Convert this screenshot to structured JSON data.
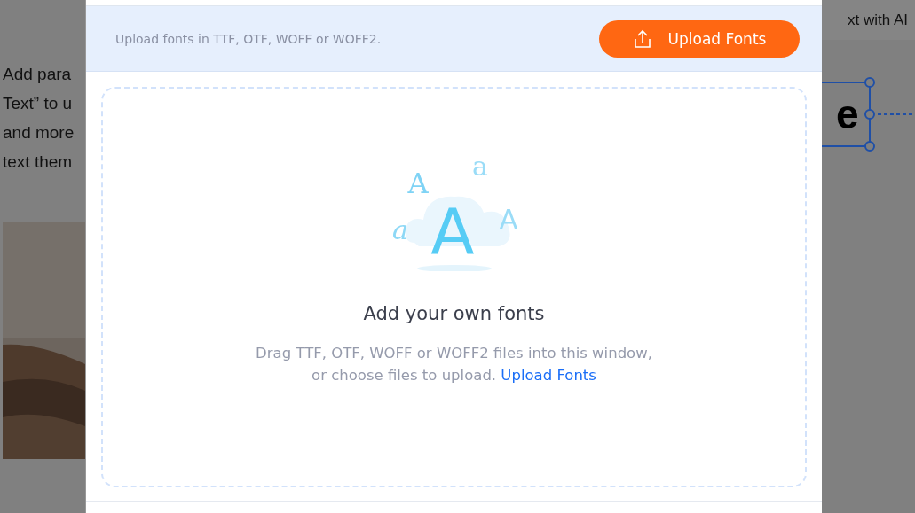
{
  "background_page": {
    "paragraph_lines": [
      "Add para",
      "Text” to u",
      "and more",
      "text them"
    ],
    "toolbar_button": "xt with AI",
    "selected_text": "e",
    "photo": {
      "kind": "picture"
    }
  },
  "dialog": {
    "info_text": "Upload fonts in TTF, OTF, WOFF or WOFF2.",
    "upload_button": "Upload Fonts",
    "drop_zone": {
      "illustration_glyphs": [
        "A",
        "a",
        "a",
        "A",
        "A"
      ],
      "title": "Add your own fonts",
      "description": "Drag TTF, OTF, WOFF or WOFF2 files into this window, or choose files to upload.",
      "link": "Upload Fonts"
    }
  }
}
